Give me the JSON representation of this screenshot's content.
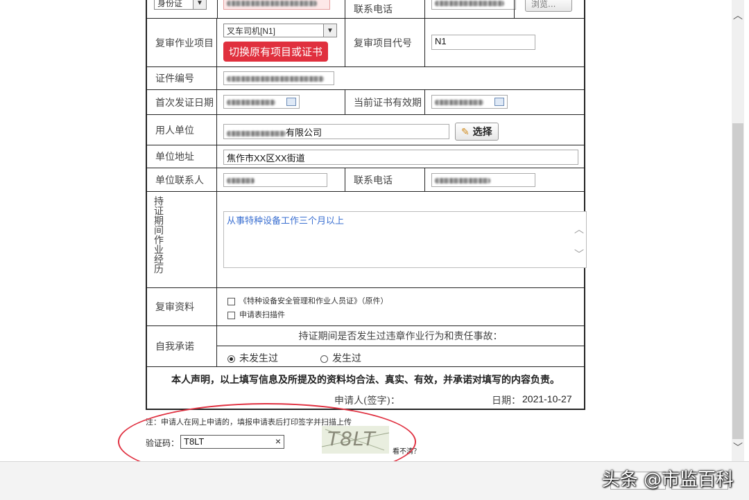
{
  "form": {
    "id_type": "身份证",
    "id_number_label": "",
    "contact_phone_label": "联系电话",
    "browse_button": "浏览...",
    "review_item_label": "复审作业项目",
    "review_item_value": "叉车司机[N1]",
    "switch_button": "切换原有项目或证书",
    "review_code_label": "复审项目代号",
    "review_code_value": "N1",
    "cert_number_label": "证件编号",
    "first_issue_label": "首次发证日期",
    "current_valid_label": "当前证书有效期",
    "employer_label": "用人单位",
    "employer_value_suffix": "有限公司",
    "choose_button": "选择",
    "address_label": "单位地址",
    "address_value": "焦作市XX区XX街道",
    "contact_person_label": "单位联系人",
    "contact_phone2_label": "联系电话",
    "experience_label": "持证期间作业经历",
    "experience_value": "从事特种设备工作三个月以上",
    "materials_label": "复审资料",
    "material_1": "《特种设备安全管理和作业人员证》（原件）",
    "material_2": "申请表扫描件",
    "commitment_label": "自我承诺",
    "commitment_question": "持证期间是否发生过违章作业行为和责任事故：",
    "option_no": "未发生过",
    "option_yes": "发生过",
    "declaration": "本人声明，以上填写信息及所提及的资料均合法、真实、有效，并承诺对填写的内容负责。",
    "signer_label": "申请人(签字)：",
    "date_label": "日期：",
    "date_value": "2021-10-27"
  },
  "note": "注：申请人在网上申请的，填报申请表后打印签字并扫描上传",
  "captcha": {
    "label": "验证码：",
    "value": "T8LT",
    "clear": "×",
    "image_text": "T8LT",
    "refresh": "看不清？"
  },
  "watermark": "头条 @市监百科"
}
